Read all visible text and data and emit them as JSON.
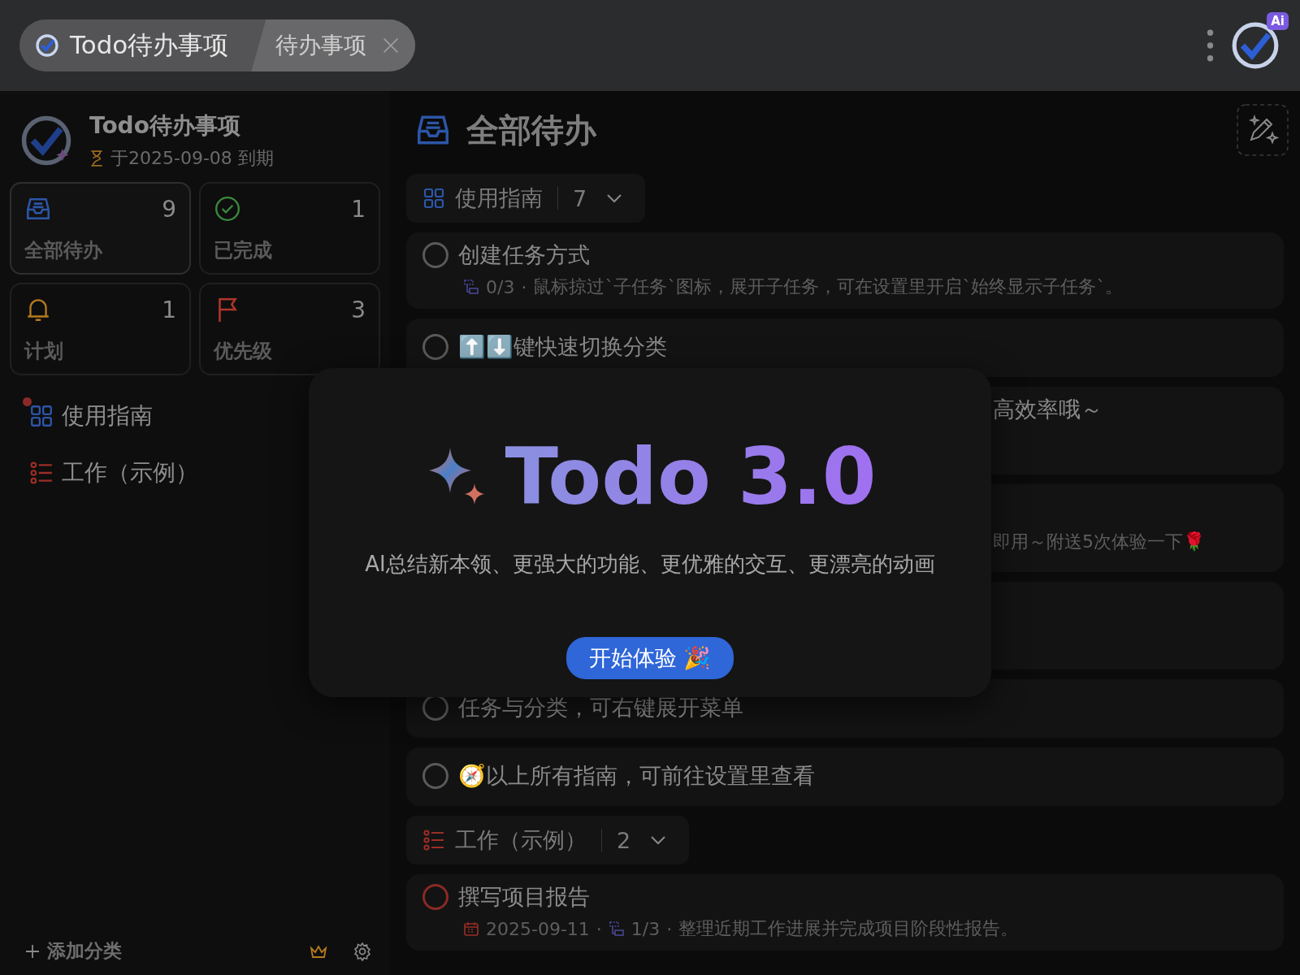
{
  "titlebar": {
    "app_tab": "Todo待办事项",
    "page_tab": "待办事项",
    "ai_badge": "Ai"
  },
  "sidebar": {
    "app_name": "Todo待办事项",
    "due": "于2025-09-08 到期",
    "stats": [
      {
        "kind": "all",
        "label": "全部待办",
        "count": "9",
        "selected": true
      },
      {
        "kind": "done",
        "label": "已完成",
        "count": "1",
        "selected": false
      },
      {
        "kind": "plan",
        "label": "计划",
        "count": "1",
        "selected": false
      },
      {
        "kind": "priority",
        "label": "优先级",
        "count": "3",
        "selected": false
      }
    ],
    "categories": [
      {
        "kind": "grid",
        "label": "使用指南",
        "unread": true
      },
      {
        "kind": "list",
        "label": "工作（示例）",
        "unread": false
      }
    ],
    "add_label": "添加分类"
  },
  "main": {
    "title": "全部待办",
    "separator": "·",
    "groups": [
      {
        "kind": "grid",
        "name": "使用指南",
        "count": "7",
        "tasks": [
          {
            "title": "创建任务方式",
            "checked": false,
            "color": "#5a5a5a",
            "subtasks": "0/3",
            "note": "鼠标掠过`子任务`图标，展开子任务，可在设置里开启`始终显示子任务`。"
          },
          {
            "title": "⬆️⬇️键快速切换分类",
            "checked": false,
            "color": "#5a5a5a"
          },
          {
            "title": "高效率哦～",
            "covered": true
          },
          {
            "note": "即用～附送5次体验一下🌹",
            "covered": true
          },
          {
            "covered": true
          },
          {
            "title": "任务与分类，可右键展开菜单",
            "checked": false,
            "color": "#5a5a5a"
          },
          {
            "title": "🧭以上所有指南，可前往设置里查看",
            "checked": false,
            "color": "#5a5a5a"
          }
        ]
      },
      {
        "kind": "list",
        "name": "工作（示例）",
        "count": "2",
        "tasks": [
          {
            "title": "撰写项目报告",
            "checked": false,
            "color": "#8a2a26",
            "date": "2025-09-11",
            "subtasks": "1/3",
            "note": "整理近期工作进展并完成项目阶段性报告。"
          }
        ]
      }
    ]
  },
  "dialog": {
    "title": "Todo 3.0",
    "text": "AI总结新本领、更强大的功能、更优雅的交互、更漂亮的动画",
    "button": "开始体验 🎉"
  }
}
